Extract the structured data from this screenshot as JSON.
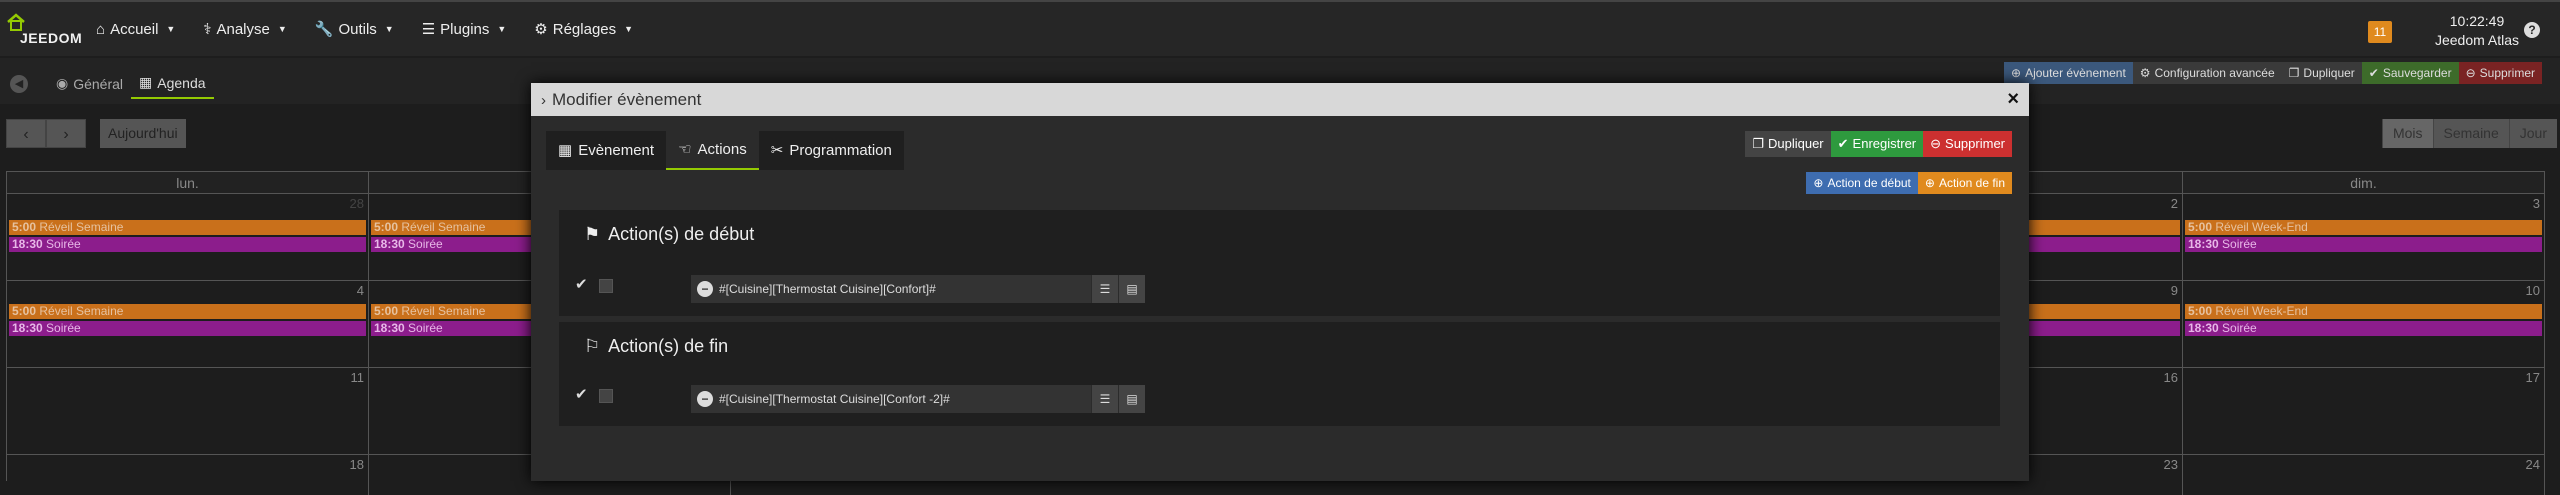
{
  "app": {
    "logo_text": "JEEDOM"
  },
  "nav": [
    {
      "icon": "home-icon",
      "glyph": "⌂",
      "label": "Accueil"
    },
    {
      "icon": "stethoscope-icon",
      "glyph": "⚕",
      "label": "Analyse"
    },
    {
      "icon": "wrench-icon",
      "glyph": "🔧",
      "label": "Outils"
    },
    {
      "icon": "list-icon",
      "glyph": "☰",
      "label": "Plugins"
    },
    {
      "icon": "gears-icon",
      "glyph": "⚙",
      "label": "Réglages"
    }
  ],
  "header": {
    "notif_count": "11",
    "time": "10:22:49",
    "user": "Jeedom Atlas"
  },
  "subtabs": {
    "general": "Général",
    "agenda": "Agenda"
  },
  "top_actions": {
    "add": "Ajouter évènement",
    "config": "Configuration avancée",
    "duplicate": "Dupliquer",
    "save": "Sauvegarder",
    "delete": "Supprimer"
  },
  "calendar": {
    "today": "Aujourd'hui",
    "views": [
      "Mois",
      "Semaine",
      "Jour"
    ],
    "days": [
      "lun.",
      "dim."
    ],
    "rows": [
      {
        "lun": "",
        "mar": "",
        "sat": "2",
        "sun": "3"
      },
      {
        "lun": "4",
        "mar": "",
        "sat": "9",
        "sun": "10"
      },
      {
        "lun": "11",
        "mar": "",
        "sat": "16",
        "sun": "17"
      },
      {
        "lun": "18",
        "mar": "",
        "sat": "23",
        "sun": "24"
      }
    ],
    "first_partial": "28",
    "events": {
      "morning_week": {
        "time": "5:00",
        "title": "Réveil Semaine"
      },
      "morning_weekend": {
        "time": "5:00",
        "title": "Réveil Week-End"
      },
      "evening": {
        "time": "18:30",
        "title": "Soirée"
      }
    }
  },
  "modal": {
    "title": "Modifier évènement",
    "tabs": [
      "Evènement",
      "Actions",
      "Programmation"
    ],
    "buttons": {
      "duplicate": "Dupliquer",
      "save": "Enregistrer",
      "delete": "Supprimer"
    },
    "add_start": "Action de début",
    "add_end": "Action de fin",
    "start_title": "Action(s) de début",
    "end_title": "Action(s) de fin",
    "start_cmd": "#[Cuisine][Thermostat Cuisine][Confort]#",
    "end_cmd": "#[Cuisine][Thermostat Cuisine][Confort -2]#"
  },
  "colors": {
    "accent": "#94ca02",
    "orange": "#c9701b",
    "purple": "#8c1d8c"
  }
}
